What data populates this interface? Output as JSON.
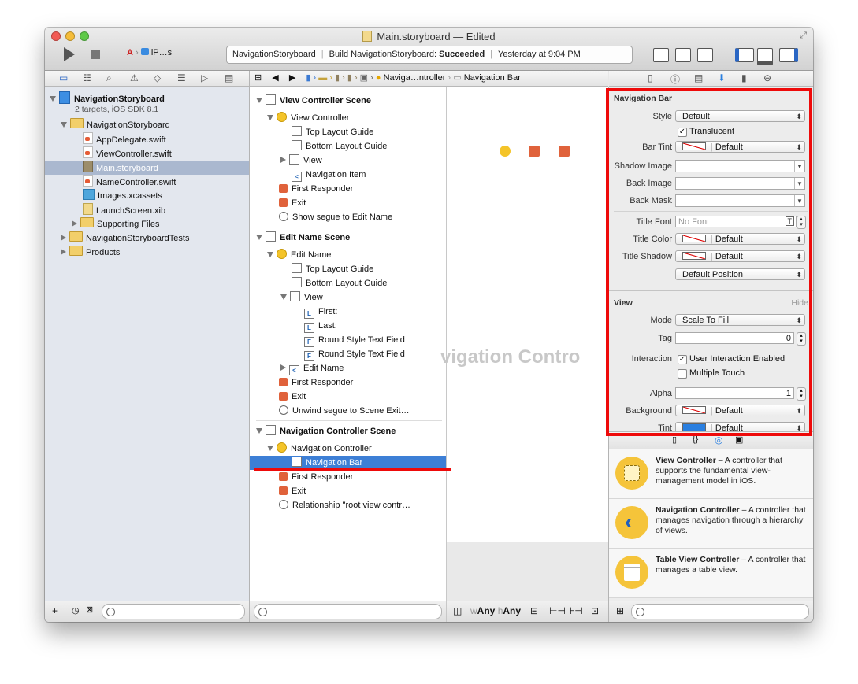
{
  "window": {
    "title": "Main.storyboard — Edited"
  },
  "toolbar": {
    "scheme_label": "iP…s",
    "activity": {
      "project": "NavigationStoryboard",
      "build_prefix": "Build NavigationStoryboard:",
      "build_status": "Succeeded",
      "time": "Yesterday at 9:04 PM"
    }
  },
  "navigator": {
    "project_name": "NavigationStoryboard",
    "project_sub": "2 targets, iOS SDK 8.1",
    "items": [
      {
        "label": "NavigationStoryboard"
      },
      {
        "label": "AppDelegate.swift"
      },
      {
        "label": "ViewController.swift"
      },
      {
        "label": "Main.storyboard"
      },
      {
        "label": "NameController.swift"
      },
      {
        "label": "Images.xcassets"
      },
      {
        "label": "LaunchScreen.xib"
      },
      {
        "label": "Supporting Files"
      },
      {
        "label": "NavigationStoryboardTests"
      },
      {
        "label": "Products"
      }
    ]
  },
  "jumpbar": {
    "crumb1": "Naviga…ntroller",
    "crumb2": "Navigation Bar"
  },
  "outline": {
    "scene1": {
      "title": "View Controller Scene",
      "items": [
        "View Controller",
        "Top Layout Guide",
        "Bottom Layout Guide",
        "View",
        "Navigation Item",
        "First Responder",
        "Exit",
        "Show segue to Edit Name"
      ]
    },
    "scene2": {
      "title": "Edit Name Scene",
      "items": [
        "Edit Name",
        "Top Layout Guide",
        "Bottom Layout Guide",
        "View",
        "First:",
        "Last:",
        "Round Style Text Field",
        "Round Style Text Field",
        "Edit Name",
        "First Responder",
        "Exit",
        "Unwind segue to Scene Exit…"
      ]
    },
    "scene3": {
      "title": "Navigation Controller Scene",
      "items": [
        "Navigation Controller",
        "Navigation Bar",
        "First Responder",
        "Exit",
        "Relationship \"root view contr…"
      ]
    }
  },
  "canvas": {
    "watermark": "vigation Contro",
    "size_w": "Any",
    "size_h": "Any",
    "w_prefix": "w",
    "h_prefix": "h"
  },
  "inspector": {
    "navbar": {
      "title": "Navigation Bar",
      "style_label": "Style",
      "style_value": "Default",
      "translucent_label": "Translucent",
      "bar_tint_label": "Bar Tint",
      "bar_tint_value": "Default",
      "shadow_image_label": "Shadow Image",
      "back_image_label": "Back Image",
      "back_mask_label": "Back Mask",
      "title_font_label": "Title Font",
      "title_font_value": "No Font",
      "title_color_label": "Title Color",
      "title_color_value": "Default",
      "title_shadow_label": "Title Shadow",
      "title_shadow_value": "Default",
      "shadow_offset_value": "Default Position"
    },
    "view": {
      "title": "View",
      "hide": "Hide",
      "mode_label": "Mode",
      "mode_value": "Scale To Fill",
      "tag_label": "Tag",
      "tag_value": "0",
      "interaction_label": "Interaction",
      "user_interaction": "User Interaction Enabled",
      "multiple_touch": "Multiple Touch",
      "alpha_label": "Alpha",
      "alpha_value": "1",
      "background_label": "Background",
      "background_value": "Default",
      "tint_label": "Tint",
      "tint_value": "Default"
    }
  },
  "library": [
    {
      "title": "View Controller",
      "desc": " – A controller that supports the fundamental view-management model in iOS."
    },
    {
      "title": "Navigation Controller",
      "desc": " – A controller that manages navigation through a hierarchy of views."
    },
    {
      "title": "Table View Controller",
      "desc": " – A controller that manages a table view."
    }
  ],
  "colors": {
    "highlight": "#ee0a0a",
    "selection": "#3d7fd6",
    "nav_selection": "#aab8cf"
  }
}
